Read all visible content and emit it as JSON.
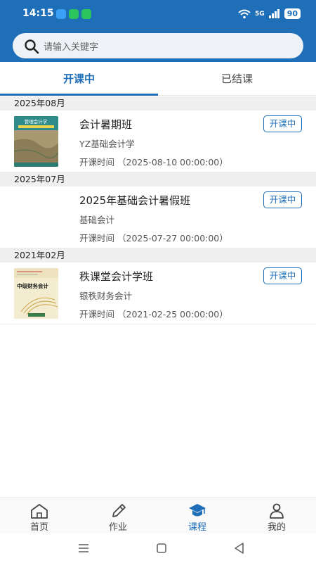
{
  "status_bar": {
    "time": "14:15",
    "network": "5G",
    "battery": "90"
  },
  "search": {
    "placeholder": "请输入关键字"
  },
  "tabs": [
    {
      "label": "开课中",
      "active": true
    },
    {
      "label": "已结课",
      "active": false
    }
  ],
  "groups": [
    {
      "month": "2025年08月",
      "course": {
        "title": "会计暑期班",
        "subject": "YZ基础会计学",
        "time_label": "开课时间",
        "time_value": "（2025-08-10 00:00:00）",
        "status": "开课中",
        "cover": "book-cover-basic-accounting"
      }
    },
    {
      "month": "2025年07月",
      "course": {
        "title": "2025年基础会计暑假班",
        "subject": "基础会计",
        "time_label": "开课时间",
        "time_value": "（2025-07-27 00:00:00）",
        "status": "开课中",
        "cover": "none"
      }
    },
    {
      "month": "2021年02月",
      "course": {
        "title": "秩课堂会计学班",
        "subject": "银秩财务会计",
        "time_label": "开课时间",
        "time_value": "（2021-02-25 00:00:00）",
        "status": "开课中",
        "cover": "book-cover-intermediate-accounting"
      }
    }
  ],
  "covers": {
    "cover1_text": "管理会计学",
    "cover3_text": "中级财务会计"
  },
  "bottom_nav": [
    {
      "label": "首页",
      "icon": "home-icon",
      "active": false
    },
    {
      "label": "作业",
      "icon": "pencil-icon",
      "active": false
    },
    {
      "label": "课程",
      "icon": "graduation-cap-icon",
      "active": true
    },
    {
      "label": "我的",
      "icon": "user-icon",
      "active": false
    }
  ],
  "colors": {
    "primary": "#1f6fb8",
    "group_header_bg": "#efefef"
  }
}
